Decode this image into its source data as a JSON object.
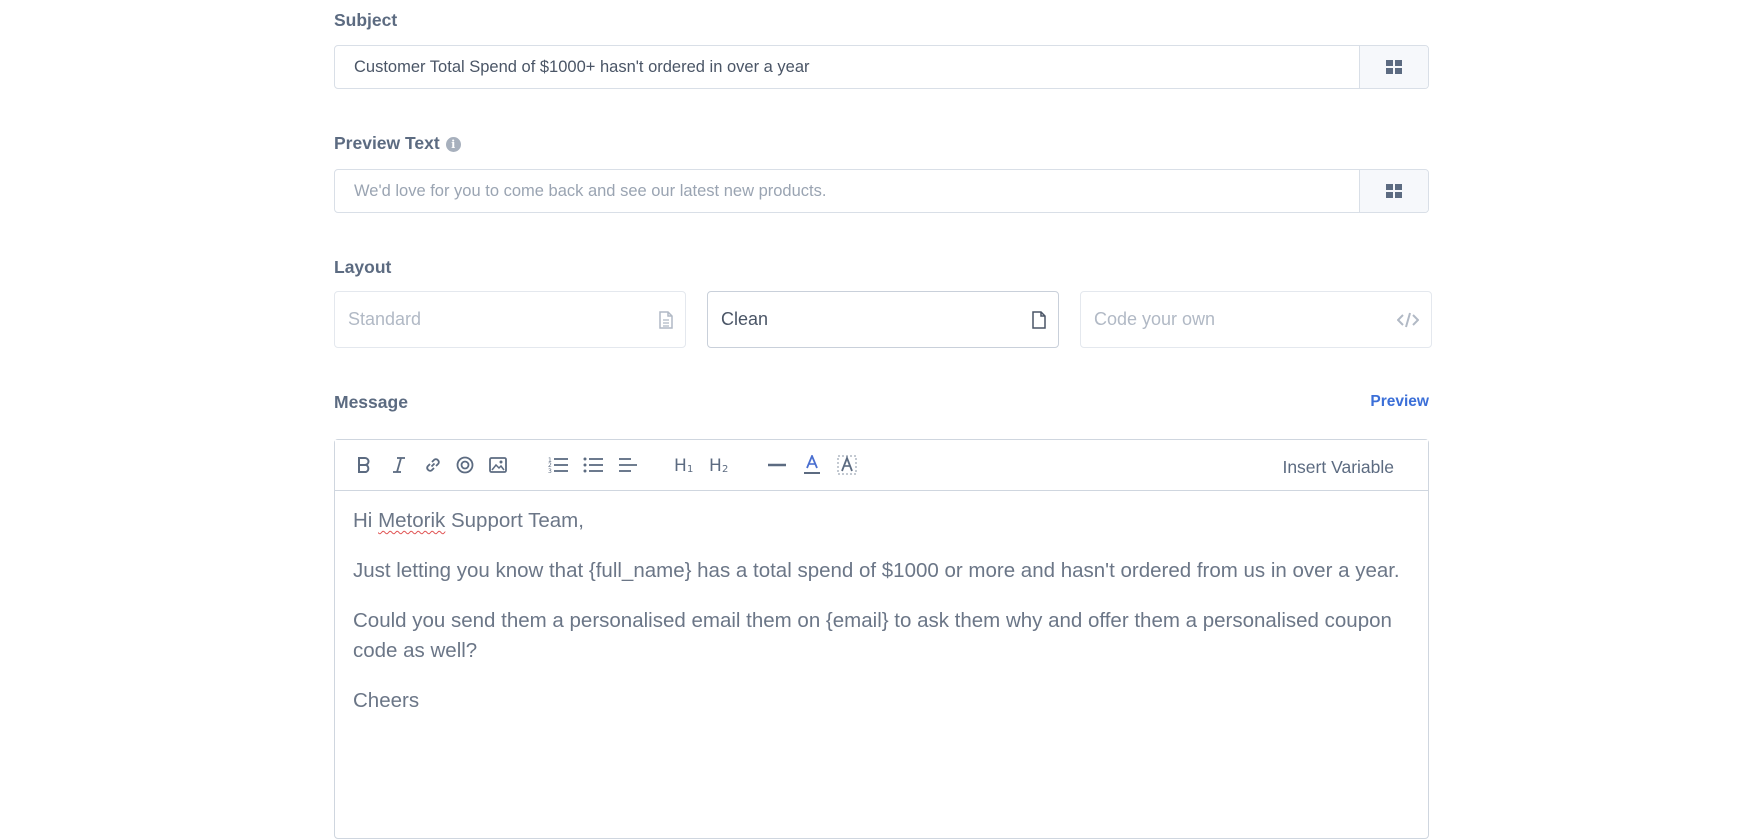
{
  "subject": {
    "label": "Subject",
    "value": "Customer Total Spend of $1000+ hasn't ordered in over a year",
    "addon_icon": "grid-icon"
  },
  "preview_text": {
    "label": "Preview Text",
    "info_icon": "info-icon",
    "placeholder": "We'd love for you to come back and see our latest new products.",
    "addon_icon": "grid-icon"
  },
  "layout": {
    "label": "Layout",
    "options": [
      {
        "label": "Standard",
        "icon": "document-lines-icon",
        "selected": false
      },
      {
        "label": "Clean",
        "icon": "document-icon",
        "selected": true
      },
      {
        "label": "Code your own",
        "icon": "code-icon",
        "selected": false
      }
    ]
  },
  "message": {
    "label": "Message",
    "preview_link": "Preview",
    "toolbar": {
      "insert_variable": "Insert Variable",
      "tools": [
        "bold-icon",
        "italic-icon",
        "link-icon",
        "target-icon",
        "image-icon",
        "ordered-list-icon",
        "bullet-list-icon",
        "align-left-icon",
        "heading-1-icon",
        "heading-2-icon",
        "horizontal-rule-icon",
        "text-color-icon",
        "clear-format-icon"
      ]
    },
    "body": {
      "greeting_prefix": "Hi ",
      "greeting_name": "Metorik",
      "greeting_suffix": " Support Team,",
      "line1": "Just letting you know that {full_name} has a total spend of $1000 or more and hasn't ordered from us in over a year.",
      "line2": "Could you send them a personalised email them on {email} to ask them why and offer them a personalised coupon code as well?",
      "line3": "Cheers"
    }
  },
  "colors": {
    "label": "#5c6b81",
    "border": "#d9dfe7",
    "link": "#3b6fd8",
    "body_text": "#6b7687"
  }
}
